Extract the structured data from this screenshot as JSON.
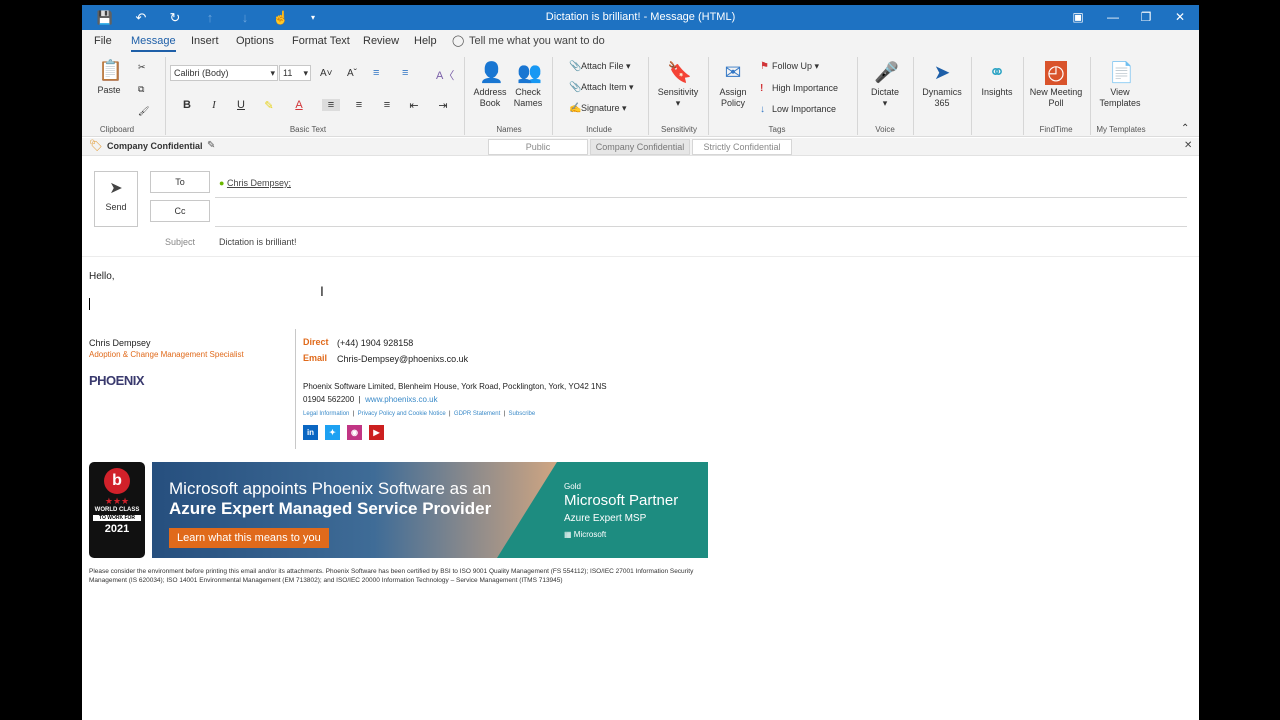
{
  "window": {
    "title": "Dictation is brilliant!  -  Message (HTML)"
  },
  "menu": {
    "tabs": [
      "File",
      "Message",
      "Insert",
      "Options",
      "Format Text",
      "Review",
      "Help"
    ],
    "tell_me": "Tell me what you want to do"
  },
  "ribbon": {
    "clipboard": {
      "paste": "Paste",
      "label": "Clipboard"
    },
    "basic_text": {
      "font": "Calibri (Body)",
      "size": "11",
      "label": "Basic Text"
    },
    "names": {
      "address_book": "Address Book",
      "check_names": "Check Names",
      "label": "Names"
    },
    "include": {
      "attach_file": "Attach File",
      "attach_item": "Attach Item",
      "signature": "Signature",
      "label": "Include"
    },
    "sensitivity": {
      "button": "Sensitivity",
      "label": "Sensitivity"
    },
    "tags": {
      "assign_policy": "Assign Policy",
      "follow_up": "Follow Up",
      "high": "High Importance",
      "low": "Low Importance",
      "label": "Tags"
    },
    "voice": {
      "dictate": "Dictate",
      "label": "Voice"
    },
    "dynamics": {
      "button": "Dynamics 365"
    },
    "insights": {
      "button": "Insights"
    },
    "findtime": {
      "button": "New Meeting Poll",
      "label": "FindTime"
    },
    "templates": {
      "button": "View Templates",
      "label": "My Templates"
    }
  },
  "infobar": {
    "label": "Company Confidential",
    "options": [
      "Public",
      "Company Confidential",
      "Strictly Confidential"
    ]
  },
  "header": {
    "send": "Send",
    "to_label": "To",
    "cc_label": "Cc",
    "subject_label": "Subject",
    "to_value": "Chris Dempsey;",
    "subject_value": "Dictation is brilliant!"
  },
  "body": {
    "greeting": "Hello,",
    "signature": {
      "name": "Chris Dempsey",
      "role": "Adoption & Change Management Specialist",
      "logo": "PHOENIX",
      "direct_label": "Direct",
      "direct_value": "(+44) 1904 928158",
      "email_label": "Email",
      "email_value": "Chris-Dempsey@phoenixs.co.uk",
      "address": "Phoenix Software Limited, Blenheim House, York Road, Pocklington, York, YO42 1NS",
      "phone": "01904 562200",
      "website": "www.phoenixs.co.uk",
      "links": [
        "Legal Information",
        "Privacy Policy and Cookie Notice",
        "GDPR Statement",
        "Subscribe"
      ]
    },
    "badge": {
      "line1": "WORLD CLASS",
      "line2": "TO WORK FOR",
      "year": "2021"
    },
    "banner": {
      "line1": "Microsoft appoints Phoenix Software as an",
      "line2": "Azure Expert Managed Service Provider",
      "cta": "Learn what this means to you",
      "gold": "Gold",
      "partner": "Microsoft Partner",
      "msp": "Azure Expert MSP",
      "ms": "Microsoft"
    },
    "footer": "Please consider the environment before printing this email and/or its attachments. Phoenix Software has been certified by BSI to ISO 9001 Quality Management (FS 554112); ISO/IEC 27001 Information Security Management (IS 620034); ISO 14001 Environmental Management (EM 713802); and ISO/IEC 20000 Information Technology – Service Management (ITMS 713945)"
  },
  "colors": {
    "titlebar": "#1e72c2",
    "accent": "#e06a1b",
    "link": "#3a8ac8"
  }
}
